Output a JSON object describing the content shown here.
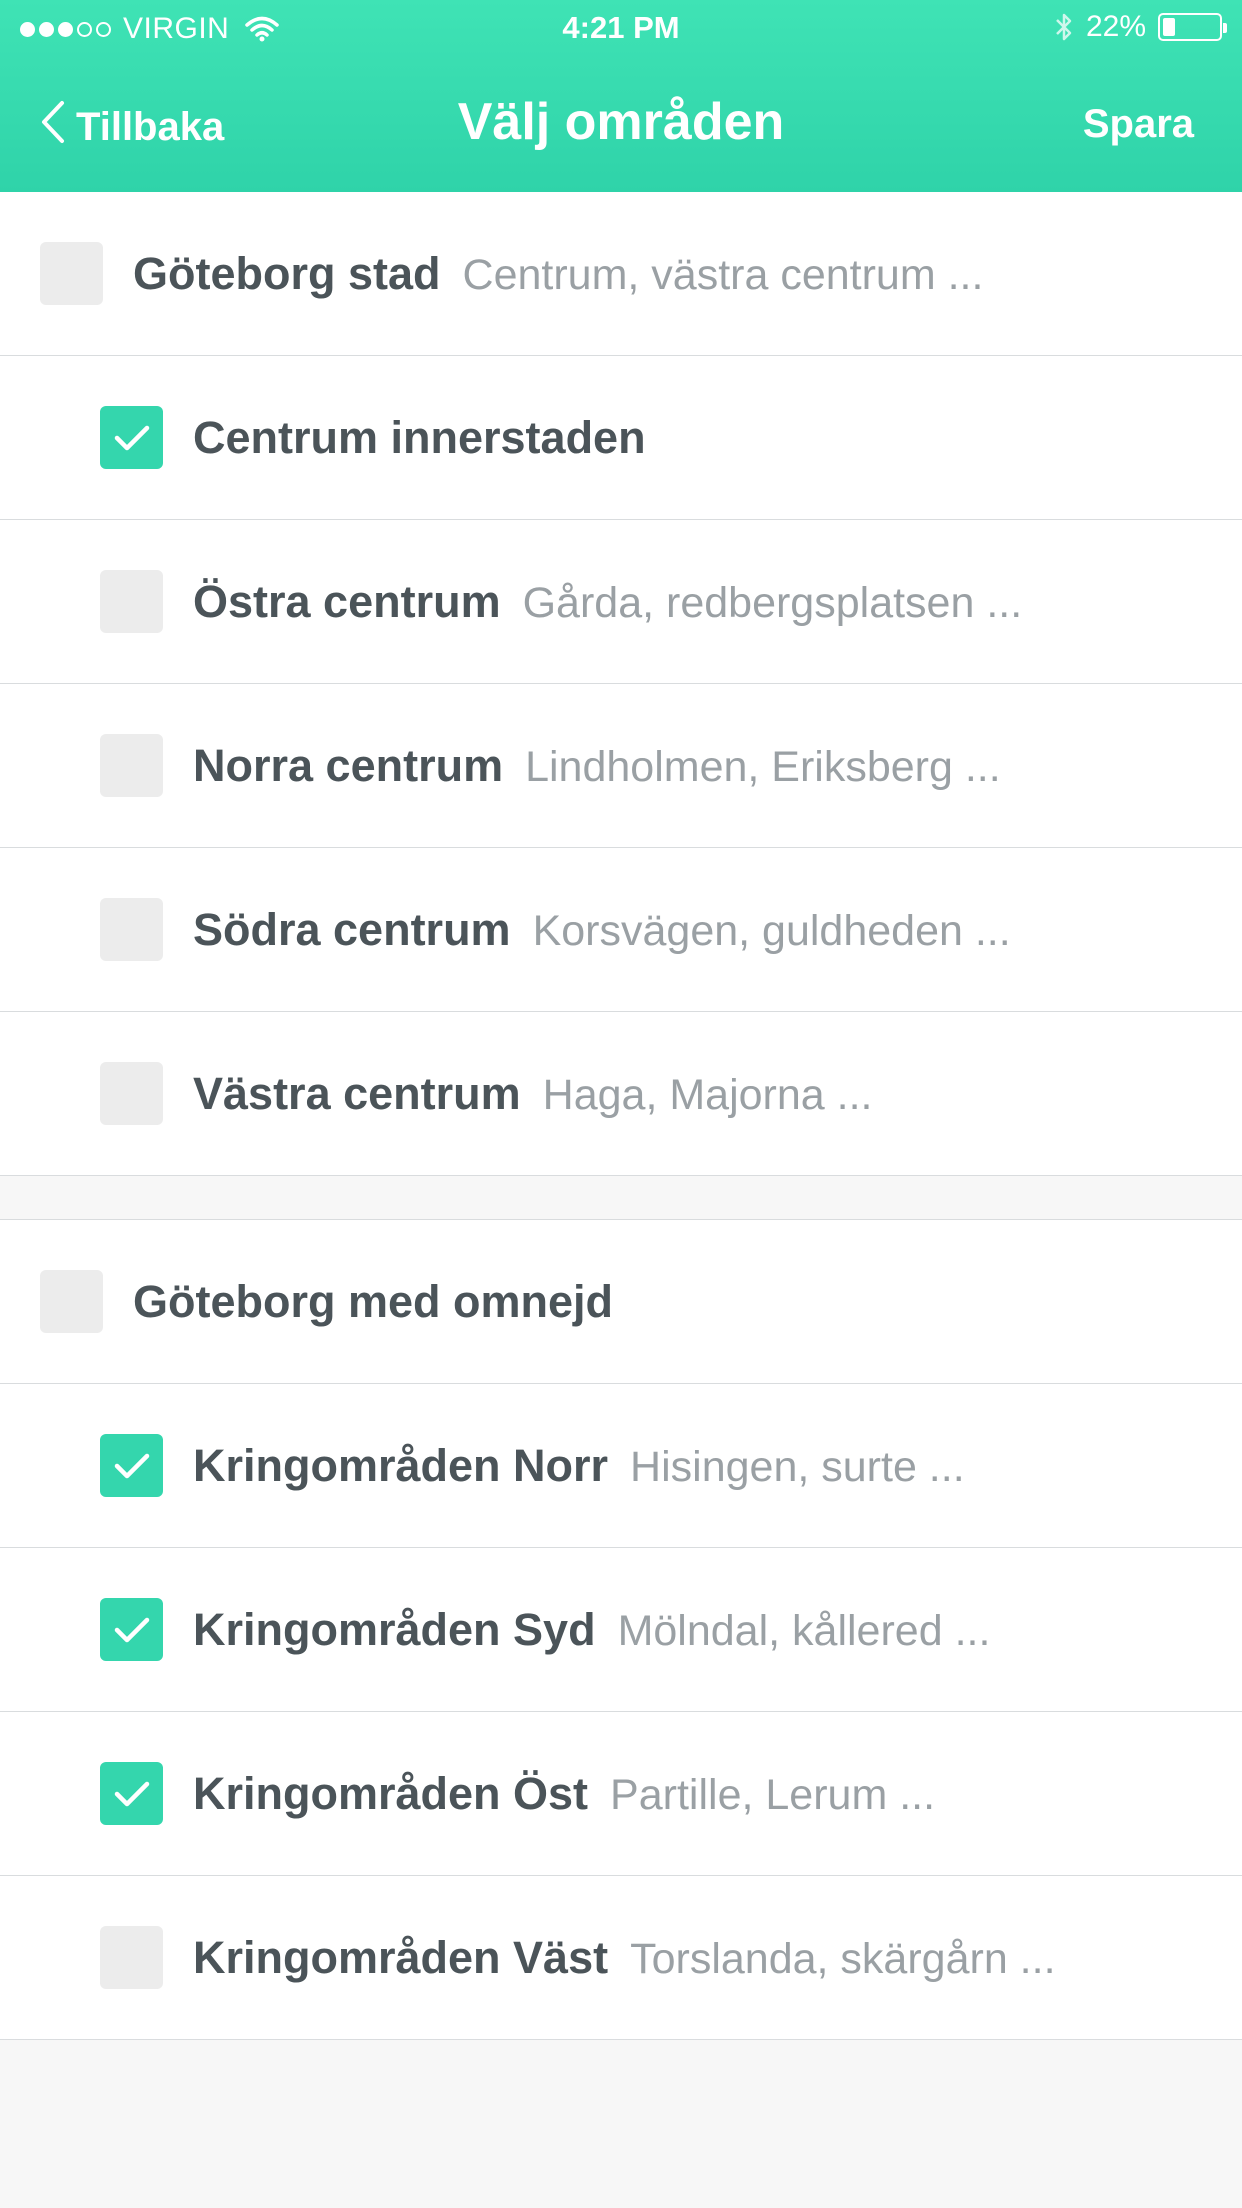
{
  "status_bar": {
    "carrier": "VIRGIN",
    "signal_filled": 3,
    "signal_total": 5,
    "time": "4:21 PM",
    "battery_percent": "22%",
    "battery_level": 0.22
  },
  "nav": {
    "back_label": "Tillbaka",
    "title": "Välj områden",
    "save_label": "Spara"
  },
  "colors": {
    "header_gradient_top": "#3fe3b5",
    "header_gradient_bottom": "#2fd3a9",
    "checkbox_checked": "#34d6ad",
    "checkbox_unchecked": "#ececec",
    "title_text": "#4b5459",
    "subtitle_text": "#9aa0a4"
  },
  "groups": [
    {
      "parent": {
        "title": "Göteborg stad",
        "subtitle": "Centrum, västra centrum ...",
        "checked": false
      },
      "children": [
        {
          "title": "Centrum innerstaden",
          "subtitle": "",
          "checked": true
        },
        {
          "title": "Östra centrum",
          "subtitle": "Gårda, redbergsplatsen ...",
          "checked": false
        },
        {
          "title": "Norra centrum",
          "subtitle": "Lindholmen, Eriksberg ...",
          "checked": false
        },
        {
          "title": "Södra centrum",
          "subtitle": "Korsvägen, guldheden ...",
          "checked": false
        },
        {
          "title": "Västra centrum",
          "subtitle": "Haga, Majorna ...",
          "checked": false
        }
      ]
    },
    {
      "parent": {
        "title": "Göteborg med omnejd",
        "subtitle": "",
        "checked": false
      },
      "children": [
        {
          "title": "Kringområden Norr",
          "subtitle": "Hisingen, surte ...",
          "checked": true
        },
        {
          "title": "Kringområden Syd",
          "subtitle": "Mölndal, kållered ...",
          "checked": true
        },
        {
          "title": "Kringområden Öst",
          "subtitle": "Partille, Lerum ...",
          "checked": true
        },
        {
          "title": "Kringområden Väst",
          "subtitle": "Torslanda, skärgårn ...",
          "checked": false
        }
      ]
    }
  ]
}
